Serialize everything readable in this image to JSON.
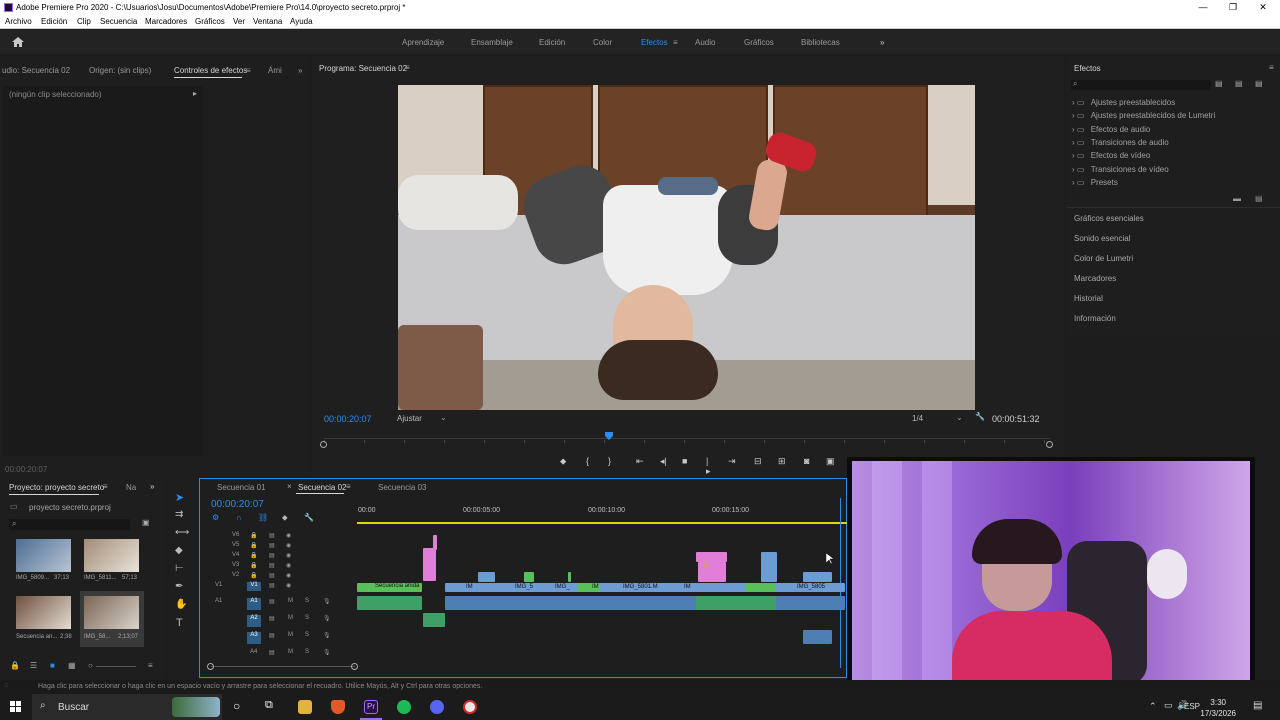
{
  "window": {
    "title": "Adobe Premiere Pro 2020 - C:\\Usuarios\\Josu\\Documentos\\Adobe\\Premiere Pro\\14.0\\proyecto secreto.prproj *"
  },
  "menu": [
    "Archivo",
    "Edición",
    "Clip",
    "Secuencia",
    "Marcadores",
    "Gráficos",
    "Ver",
    "Ventana",
    "Ayuda"
  ],
  "workspaces": [
    "Aprendizaje",
    "Ensamblaje",
    "Edición",
    "Color",
    "Efectos",
    "Audio",
    "Gráficos",
    "Bibliotecas"
  ],
  "active_workspace": "Efectos",
  "source_panel": {
    "tabs": [
      "udio: Secuencia 02",
      "Origen: (sin clips)",
      "Controles de efectos",
      "Ámi"
    ],
    "empty_text": "(ningún clip seleccionado)",
    "timecode": "00:00:20:07"
  },
  "program_panel": {
    "title": "Programa: Secuencia 02",
    "timecode": "00:00:20:07",
    "fit": "Ajustar",
    "resolution": "1/4",
    "duration": "00:00:51:32",
    "playhead": 0.392
  },
  "effects_panel": {
    "title": "Efectos",
    "tree": [
      "Ajustes preestablecidos",
      "Ajustes preestablecidos de Lumetri",
      "Efectos de audio",
      "Transiciones de audio",
      "Efectos de vídeo",
      "Transiciones de vídeo",
      "Presets"
    ],
    "sections": [
      "Gráficos esenciales",
      "Sonido esencial",
      "Color de Lumetri",
      "Marcadores",
      "Historial",
      "Información"
    ]
  },
  "project_panel": {
    "tab": "Proyecto: proyecto secreto",
    "tab2": "Na",
    "file": "proyecto secreto.prproj",
    "items": [
      {
        "name": "IMG_5809...",
        "duration": "37;13"
      },
      {
        "name": "IMG_5811...",
        "duration": "57;13"
      },
      {
        "name": "Secuencia an...",
        "duration": "2;38"
      },
      {
        "name": "IMG_58...",
        "duration": "2;13;07"
      }
    ]
  },
  "timeline": {
    "tabs": [
      "Secuencia 01",
      "Secuencia 02",
      "Secuencia 03"
    ],
    "active_tab": "Secuencia 02",
    "timecode": "00:00:20:07",
    "ruler": [
      "00:00",
      "00:00:05:00",
      "00:00:10:00",
      "00:00:15:00"
    ],
    "video_tracks": [
      "V6",
      "V5",
      "V4",
      "V3",
      "V2",
      "V1"
    ],
    "audio_tracks": [
      "A1",
      "A2",
      "A3",
      "A4"
    ],
    "clip_labels": [
      "Secuencia anida",
      "IM",
      "IMG_5",
      "IMG_",
      "IM",
      "IMG_5801.M",
      "IM",
      "IMG_5805",
      "fx"
    ]
  },
  "status": "Haga clic para seleccionar o haga clic en un espacio vacío y arrastre para seleccionar el recuadro. Utilice Mayús, Alt y Ctrl para otras opciones.",
  "taskbar": {
    "search": "Buscar",
    "lang": "ESP",
    "time": "3:30",
    "date": "17/3/2026"
  },
  "colors": {
    "accent": "#2d8ceb",
    "timeline_yellow": "#d9d900",
    "video_clip": "#6d9bd3",
    "pink_clip": "#e17ed8",
    "green_clip": "#58c05a"
  }
}
